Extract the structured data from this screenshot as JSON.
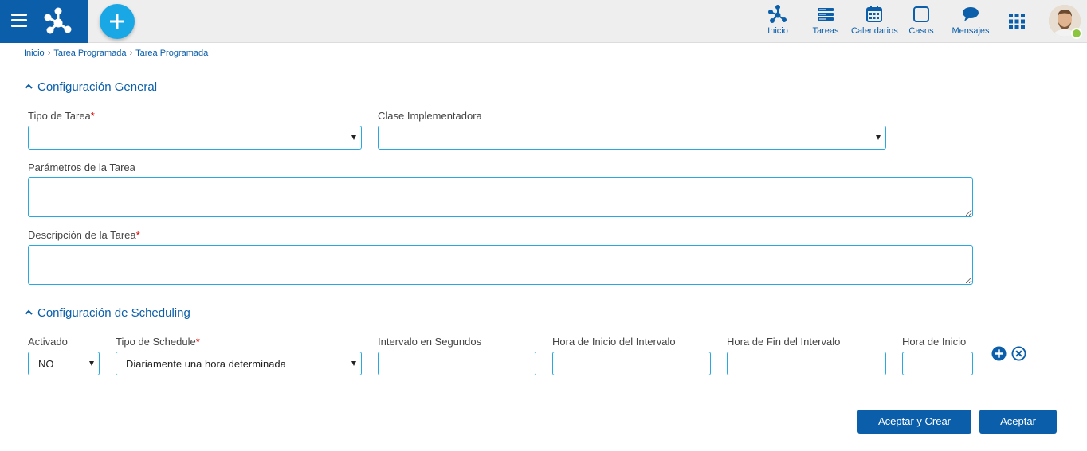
{
  "topbar": {
    "nav": [
      {
        "label": "Inicio",
        "icon": "process-icon"
      },
      {
        "label": "Tareas",
        "icon": "tasks-icon"
      },
      {
        "label": "Calendarios",
        "icon": "calendar-icon"
      },
      {
        "label": "Casos",
        "icon": "cases-icon"
      },
      {
        "label": "Mensajes",
        "icon": "message-icon"
      }
    ],
    "apps_icon": "grid-icon",
    "accent": "#0a5eaa",
    "add_color": "#1aa7e6",
    "status_color": "#8cc63f"
  },
  "breadcrumb": [
    "Inicio",
    "Tarea Programada",
    "Tarea Programada"
  ],
  "general": {
    "title": "Configuración General",
    "tipo_tarea": {
      "label": "Tipo de Tarea",
      "required": "*",
      "value": ""
    },
    "clase": {
      "label": "Clase Implementadora",
      "value": ""
    },
    "parametros": {
      "label": "Parámetros de la Tarea",
      "value": ""
    },
    "descripcion": {
      "label": "Descripción de la Tarea",
      "required": "*",
      "value": ""
    }
  },
  "scheduling": {
    "title": "Configuración de Scheduling",
    "activado": {
      "label": "Activado",
      "value": "NO"
    },
    "tipo_schedule": {
      "label": "Tipo de Schedule",
      "required": "*",
      "value": "Diariamente una hora determinada"
    },
    "intervalo": {
      "label": "Intervalo en Segundos",
      "value": ""
    },
    "hora_inicio_intervalo": {
      "label": "Hora de Inicio del Intervalo",
      "value": ""
    },
    "hora_fin_intervalo": {
      "label": "Hora de Fin del Intervalo",
      "value": ""
    },
    "hora_inicio": {
      "label": "Hora de Inicio",
      "value": ""
    }
  },
  "actions": {
    "accept_create": "Aceptar y Crear",
    "accept": "Aceptar"
  }
}
